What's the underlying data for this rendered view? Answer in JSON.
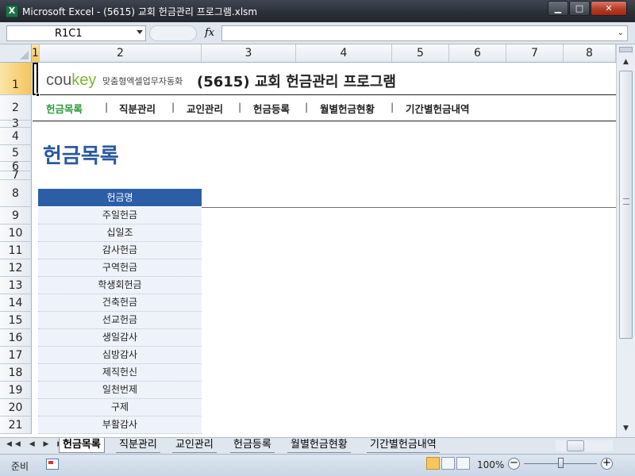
{
  "window": {
    "title": "Microsoft Excel - (5615) 교회 헌금관리 프로그램.xlsm",
    "app_icon": "X",
    "minimize_icon": "▁",
    "maximize_icon": "□",
    "close_icon": "✕"
  },
  "formula_bar": {
    "name_box": "R1C1",
    "fx": "fx",
    "formula": "",
    "expand_icon": "⌄"
  },
  "columns": [
    "1",
    "2",
    "3",
    "4",
    "5",
    "6",
    "7",
    "8"
  ],
  "rows": [
    "1",
    "2",
    "3",
    "4",
    "5",
    "6",
    "7",
    "8",
    "9",
    "10",
    "11",
    "12",
    "13",
    "14",
    "15",
    "16",
    "17",
    "18",
    "19",
    "20",
    "21"
  ],
  "selected_cell": {
    "row": "1",
    "col": "1"
  },
  "brand": {
    "logo_prefix": "cou",
    "logo_suffix": "key",
    "tagline": "맞춤형엑셀업무자동화",
    "app_title": "(5615) 교회 헌금관리 프로그램"
  },
  "nav": {
    "items": [
      "헌금목록",
      "직분관리",
      "교인관리",
      "헌금등록",
      "월별헌금현황",
      "기간별헌금내역"
    ],
    "active": "헌금목록",
    "separator": "|"
  },
  "page_title": "헌금목록",
  "table": {
    "header": "헌금명",
    "items": [
      "주일헌금",
      "십일조",
      "감사헌금",
      "구역헌금",
      "학생회헌금",
      "건축헌금",
      "선교헌금",
      "생일감사",
      "심방감사",
      "제직헌신",
      "일천번제",
      "구제",
      "부활감사"
    ]
  },
  "sheet_tabs": {
    "nav_arrows": "◀◀ ◀ ▶ ▶▶",
    "tabs": [
      "헌금목록",
      "직분관리",
      "교인관리",
      "헌금등록",
      "월별헌금현황",
      "기간별헌금내역"
    ],
    "active": "헌금목록"
  },
  "status_bar": {
    "status": "준비",
    "zoom": "100%",
    "zoom_minus": "−",
    "zoom_plus": "+"
  },
  "colors": {
    "accent_blue": "#2c5ea8",
    "title_blue": "#2a59a0",
    "nav_active_green": "#2e9a3e",
    "selection_orange": "#f5c45e"
  }
}
